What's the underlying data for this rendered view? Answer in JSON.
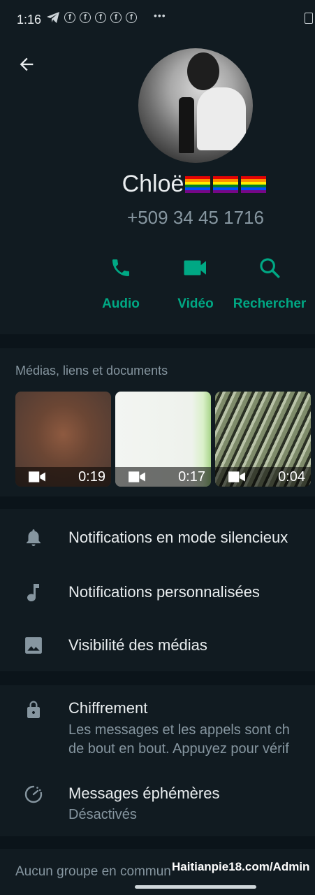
{
  "status": {
    "time": "1:16",
    "more": "•••"
  },
  "contact": {
    "name": "Chloë",
    "phone": "+509 34 45 1716"
  },
  "actions": [
    {
      "label": "Audio",
      "icon": "phone-icon"
    },
    {
      "label": "Vidéo",
      "icon": "video-icon"
    },
    {
      "label": "Rechercher",
      "icon": "search-icon"
    }
  ],
  "media": {
    "title": "Médias, liens et documents",
    "items": [
      {
        "duration": "0:19",
        "icon": "video-camera-icon"
      },
      {
        "duration": "0:17",
        "icon": "video-camera-icon"
      },
      {
        "duration": "0:04",
        "icon": "video-camera-icon"
      }
    ]
  },
  "settings": {
    "silent": "Notifications en mode silencieux",
    "custom": "Notifications personnalisées",
    "visibility": "Visibilité des médias",
    "encryption_title": "Chiffrement",
    "encryption_line1": "Les messages et les appels sont ch",
    "encryption_line2": "de bout en bout. Appuyez pour vérif",
    "ephemeral_title": "Messages éphémères",
    "ephemeral_sub": "Désactivés"
  },
  "groups": {
    "label": "Aucun groupe en commun"
  },
  "watermark": "Haitianpie18.com/Admin",
  "colors": {
    "accent": "#00a884",
    "bg": "#0b141a",
    "surface": "#111b21",
    "muted": "#8696a0"
  }
}
